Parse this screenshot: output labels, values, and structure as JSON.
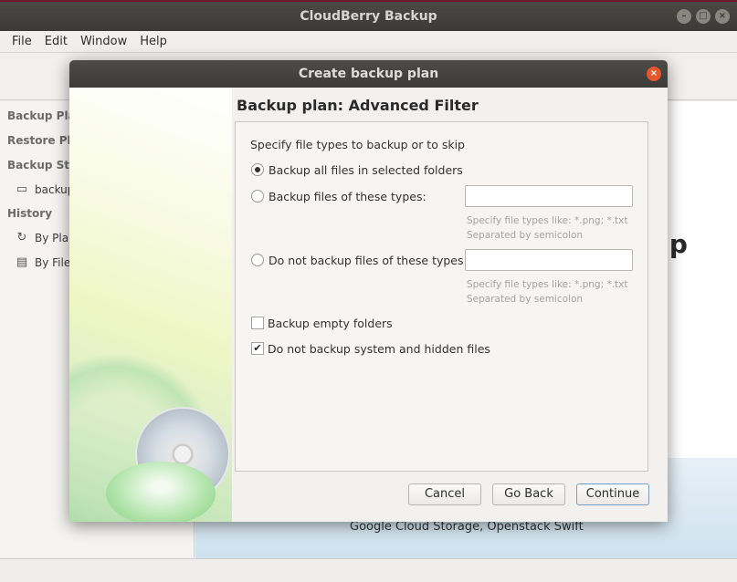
{
  "window": {
    "title": "CloudBerry Backup",
    "controls": [
      "–",
      "□",
      "×"
    ]
  },
  "menubar": {
    "items": [
      "File",
      "Edit",
      "Window",
      "Help"
    ]
  },
  "sidebar": {
    "backup_plans": "Backup Plans",
    "restore_plans": "Restore Plans",
    "backup_storage": "Backup Storage",
    "storage_item": "backup",
    "history": "History",
    "by_plan": "By Plan",
    "by_file": "By File"
  },
  "background": {
    "big_text": "up",
    "storage_text": "Google Cloud Storage, Openstack Swift"
  },
  "dialog": {
    "title": "Create backup plan",
    "heading": "Backup plan: Advanced Filter",
    "intro": "Specify file types to backup or to skip",
    "options": {
      "all_files": "Backup all files in selected folders",
      "these_types": "Backup files of these types:",
      "not_these_types": "Do not backup files of these types:"
    },
    "inputs": {
      "these_types_value": "",
      "not_these_types_value": ""
    },
    "hint_line1": "Specify file types like: *.png; *.txt",
    "hint_line2": "Separated by semicolon",
    "checkboxes": {
      "empty_folders": "Backup empty folders",
      "skip_system_hidden": "Do not backup system and hidden files"
    },
    "buttons": {
      "cancel": "Cancel",
      "go_back": "Go Back",
      "continue": "Continue"
    }
  }
}
